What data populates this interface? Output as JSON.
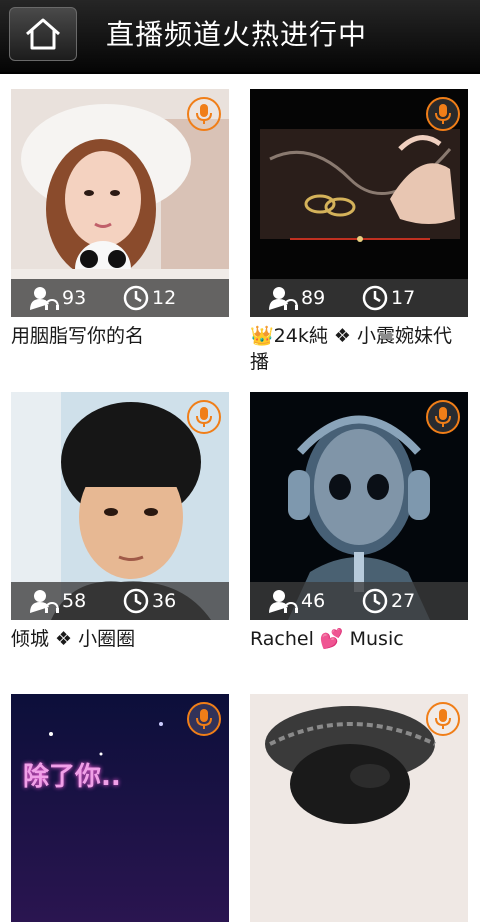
{
  "header": {
    "title": "直播频道火热进行中",
    "home_icon": "home-icon"
  },
  "channels": [
    {
      "name": "用胭脂写你的名",
      "viewers": "93",
      "duration": "12"
    },
    {
      "name": "👑24k純 ❖ 小震婉妹代播",
      "viewers": "89",
      "duration": "17"
    },
    {
      "name": "倾城 ❖ 小圈圈",
      "viewers": "58",
      "duration": "36"
    },
    {
      "name": "Rachel 💕 Music",
      "viewers": "46",
      "duration": "27"
    },
    {
      "name": "",
      "viewers": "",
      "duration": "",
      "overlay_text": "除了你.."
    },
    {
      "name": "",
      "viewers": "",
      "duration": ""
    }
  ],
  "colors": {
    "accent": "#f07e18",
    "header": "#111111",
    "stats_bg": "#3c3c3c"
  }
}
